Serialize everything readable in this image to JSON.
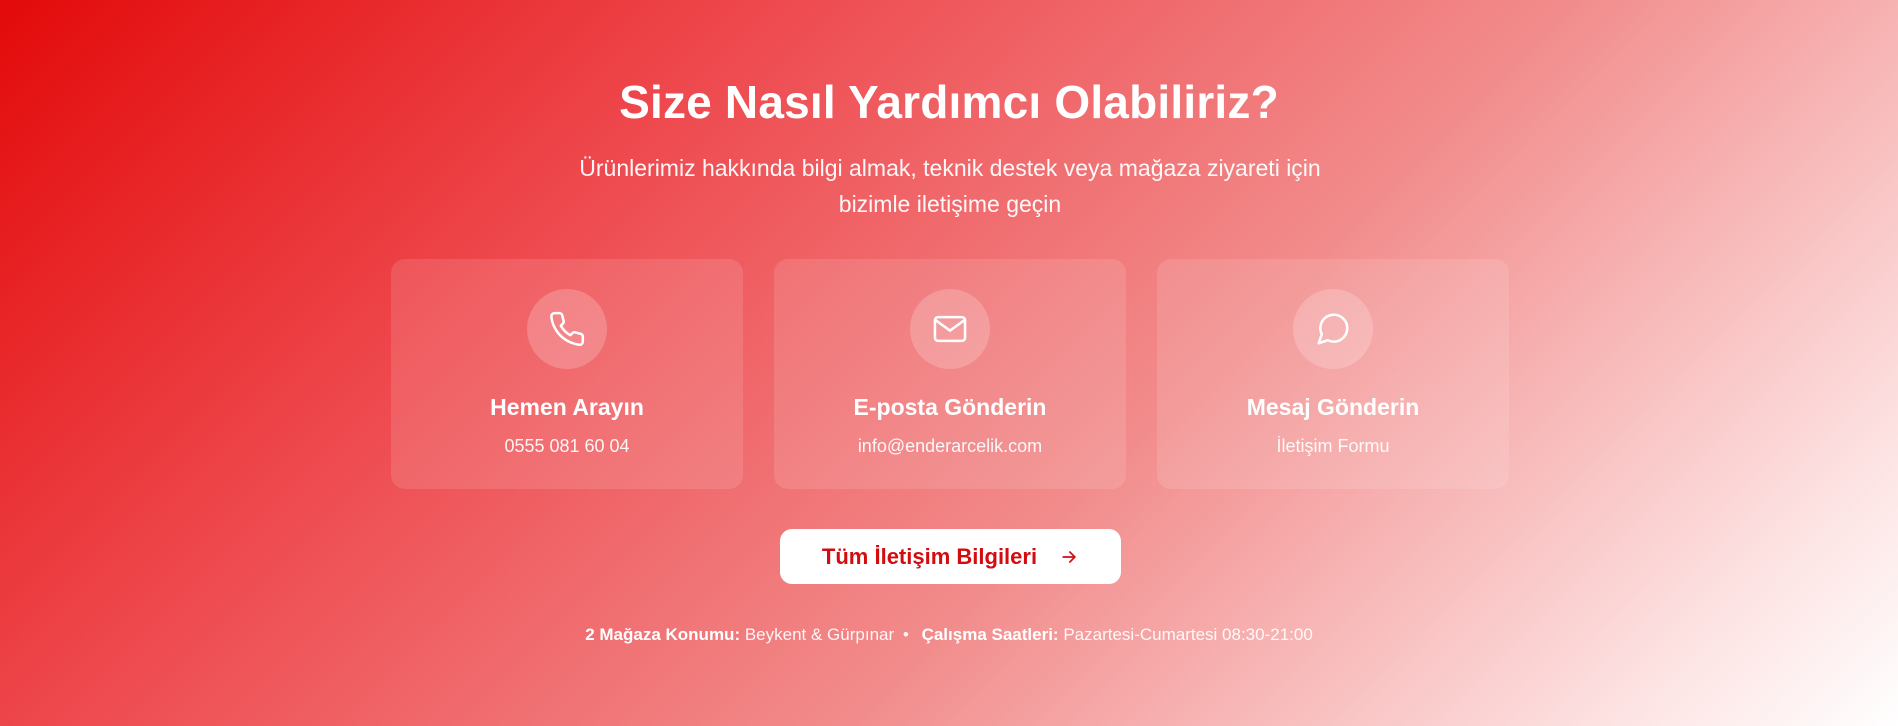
{
  "header": {
    "title": "Size Nasıl Yardımcı Olabiliriz?",
    "subtitle": "Ürünlerimiz hakkında bilgi almak, teknik destek veya mağaza ziyareti için bizimle iletişime geçin"
  },
  "cards": [
    {
      "icon": "phone-icon",
      "title": "Hemen Arayın",
      "text": "0555 081 60 04"
    },
    {
      "icon": "mail-icon",
      "title": "E-posta Gönderin",
      "text": "info@enderarcelik.com"
    },
    {
      "icon": "message-circle-icon",
      "title": "Mesaj Gönderin",
      "text": "İletişim Formu"
    }
  ],
  "cta": {
    "label": "Tüm İletişim Bilgileri",
    "icon": "arrow-right-icon"
  },
  "footer": {
    "locations_label": "2 Mağaza Konumu:",
    "locations_value": "Beykent & Gürpınar",
    "separator": "•",
    "hours_label": "Çalışma Saatleri:",
    "hours_value": "Pazartesi-Cumartesi 08:30-21:00"
  },
  "colors": {
    "gradient_start": "#e30a0a",
    "gradient_end": "#ffffff",
    "button_text": "#d10d10"
  }
}
